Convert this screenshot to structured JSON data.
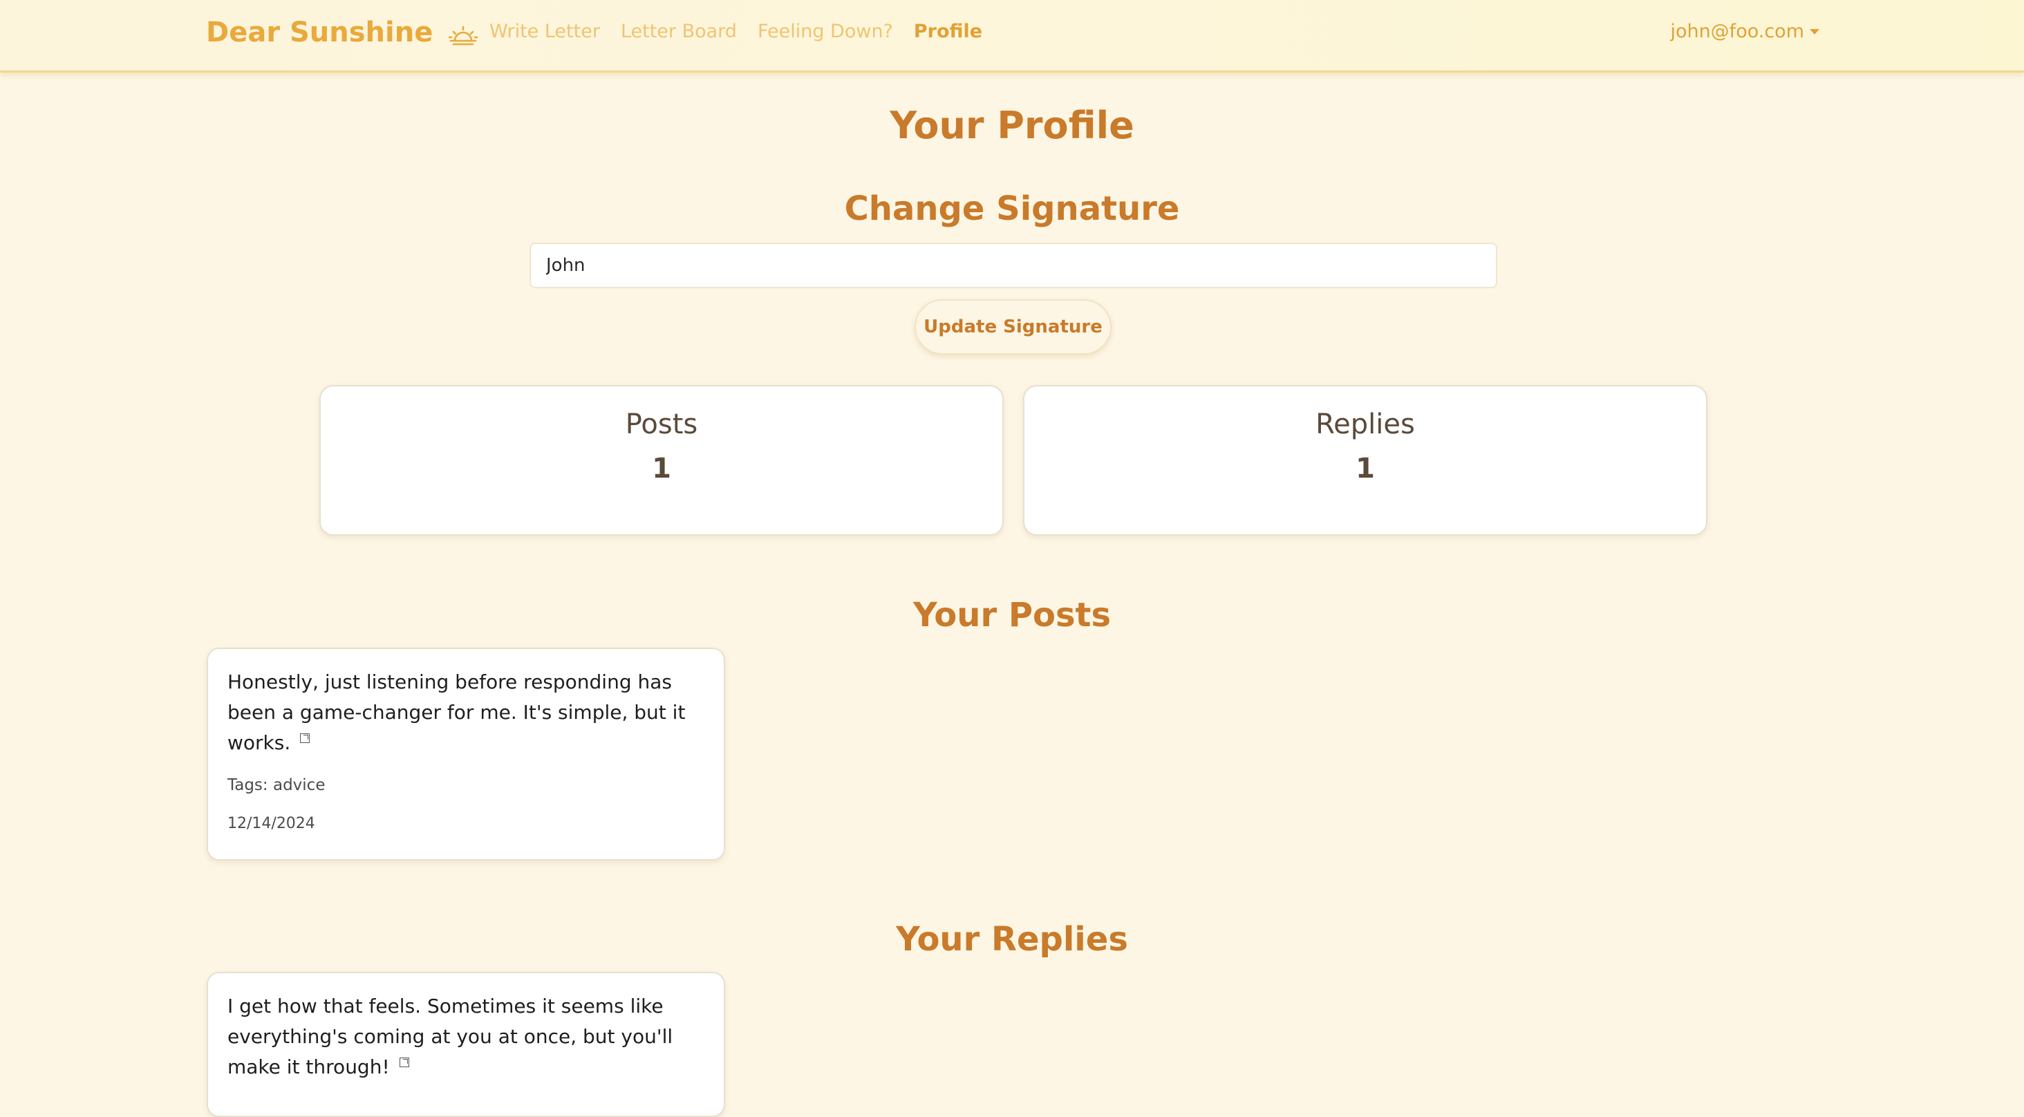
{
  "nav": {
    "brand": "Dear Sunshine",
    "links": [
      "Write Letter",
      "Letter Board",
      "Feeling Down?",
      "Profile"
    ],
    "active_link": "Profile",
    "user_email": "john@foo.com"
  },
  "page": {
    "title": "Your Profile"
  },
  "signature": {
    "title": "Change Signature",
    "value": "John",
    "button_label": "Update Signature"
  },
  "stats": {
    "posts_label": "Posts",
    "posts_count": "1",
    "replies_label": "Replies",
    "replies_count": "1"
  },
  "posts": {
    "title": "Your Posts",
    "items": [
      {
        "text": "Honestly, just listening before responding has been a game-changer for me. It's simple, but it works.",
        "tags": "Tags: advice",
        "date": "12/14/2024"
      }
    ]
  },
  "replies": {
    "title": "Your Replies",
    "items": [
      {
        "text": "I get how that feels. Sometimes it seems like everything's coming at you at once, but you'll make it through!"
      }
    ]
  },
  "colors": {
    "accent": "#c97a2a",
    "brand": "#e9a93b",
    "background": "#fdf6e4"
  }
}
